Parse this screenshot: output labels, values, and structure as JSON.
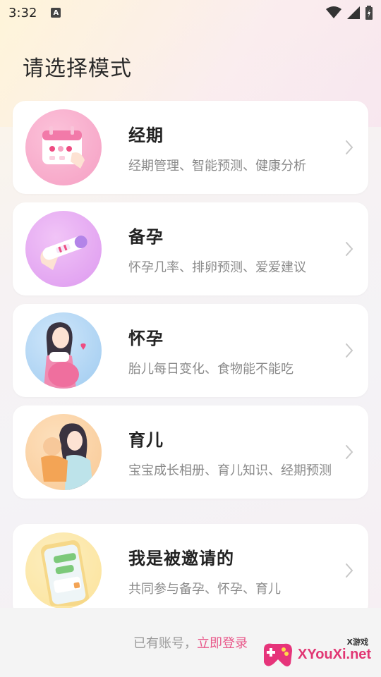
{
  "status_bar": {
    "time": "3:32",
    "notification_icon_letter": "A",
    "icons": [
      "wifi-icon",
      "signal-icon",
      "battery-charging-icon"
    ]
  },
  "page": {
    "title": "请选择模式"
  },
  "modes": [
    {
      "title": "经期",
      "description": "经期管理、智能预测、健康分析",
      "icon": "calendar-illustration-icon",
      "color": "#f6a7c7"
    },
    {
      "title": "备孕",
      "description": "怀孕几率、排卵预测、爱爱建议",
      "icon": "pregnancy-test-illustration-icon",
      "color": "#e4a4f0"
    },
    {
      "title": "怀孕",
      "description": "胎儿每日变化、食物能不能吃",
      "icon": "pregnant-woman-illustration-icon",
      "color": "#a9d1f2"
    },
    {
      "title": "育儿",
      "description": "宝宝成长相册、育儿知识、经期预测",
      "icon": "mother-baby-illustration-icon",
      "color": "#fbd5a8"
    },
    {
      "title": "我是被邀请的",
      "description": "共同参与备孕、怀孕、育儿",
      "icon": "phone-chat-illustration-icon",
      "color": "#fbe6a2"
    }
  ],
  "footer": {
    "prefix": "已有账号，",
    "login_link": "立即登录"
  },
  "watermark": {
    "text": "XYouXi.net",
    "small": "X游戏"
  },
  "colors": {
    "accent": "#e8588a",
    "card_bg": "#ffffff",
    "desc_text": "#8a8a8a"
  }
}
